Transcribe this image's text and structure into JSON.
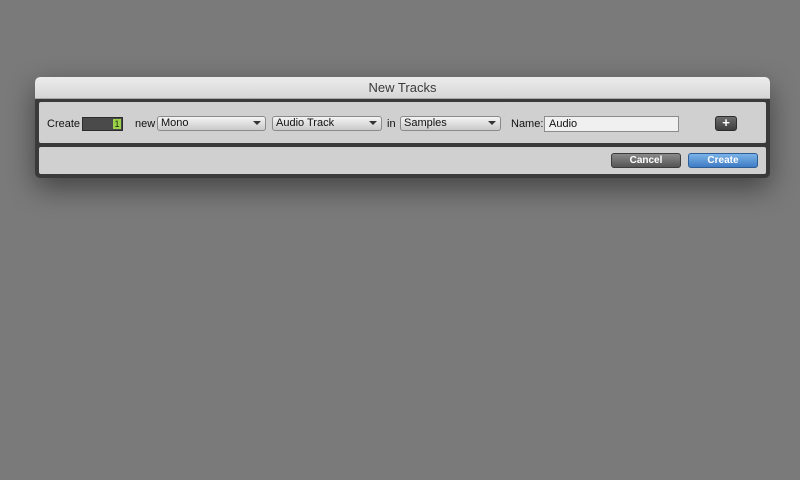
{
  "dialog": {
    "title": "New Tracks",
    "create_label": "Create",
    "count_value": "1",
    "new_label": "new",
    "format_select": "Mono",
    "type_select": "Audio Track",
    "in_label": "in",
    "timebase_select": "Samples",
    "name_label": "Name:",
    "name_value": "Audio",
    "add_row_symbol": "+",
    "cancel_label": "Cancel",
    "create_button_label": "Create"
  },
  "colors": {
    "background": "#7a7a7a",
    "count_highlight": "#9bd24a",
    "create_button": "#4a8ad4"
  }
}
